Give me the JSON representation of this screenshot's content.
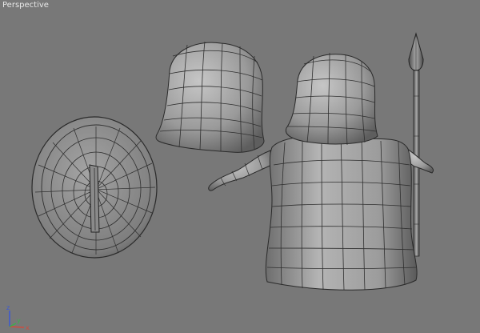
{
  "viewport": {
    "label": "Perspective"
  },
  "gizmo": {
    "z": "z",
    "x": "x",
    "y": "y",
    "colors": {
      "x": "#d24a3c",
      "y": "#39b04a",
      "z": "#3a58d6"
    }
  },
  "scene": {
    "objects": [
      "helmet-mesh",
      "shield-mesh",
      "body-mesh",
      "spear-mesh"
    ],
    "mesh_color": "#9b9b9b",
    "wire_color": "#2a2a2a"
  }
}
